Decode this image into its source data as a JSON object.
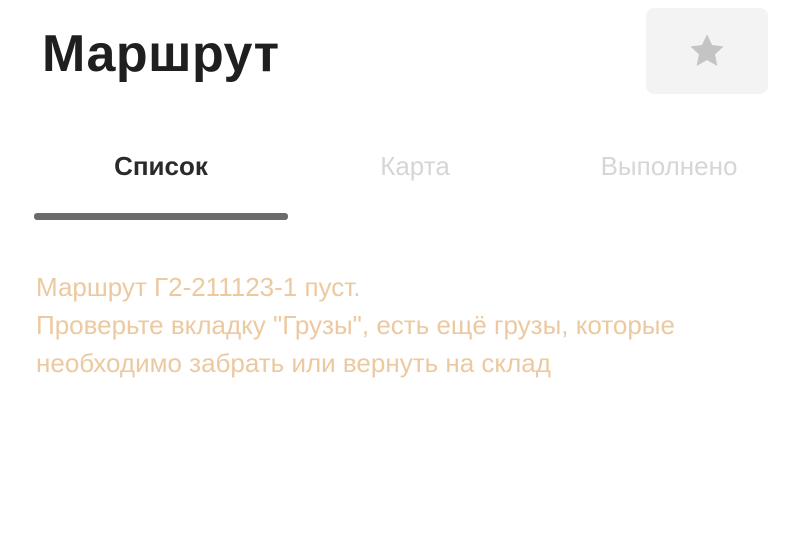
{
  "header": {
    "title": "Маршрут",
    "favorite_icon": "star-icon"
  },
  "tabs": [
    {
      "label": "Список",
      "active": true
    },
    {
      "label": "Карта",
      "active": false
    },
    {
      "label": "Выполнено",
      "active": false
    }
  ],
  "notice": {
    "line1": "Маршрут Г2-211123-1 пуст.",
    "line2": "Проверьте вкладку \"Грузы\", есть ещё грузы, которые необходимо забрать или вернуть на склад"
  },
  "colors": {
    "title": "#1f1f1f",
    "tab_active": "#2a2a2a",
    "tab_inactive": "#d6d6d6",
    "indicator": "#6b6b6b",
    "notice_text": "#ecc9a0",
    "button_bg": "#f3f3f3",
    "star": "#c4c4c4"
  }
}
